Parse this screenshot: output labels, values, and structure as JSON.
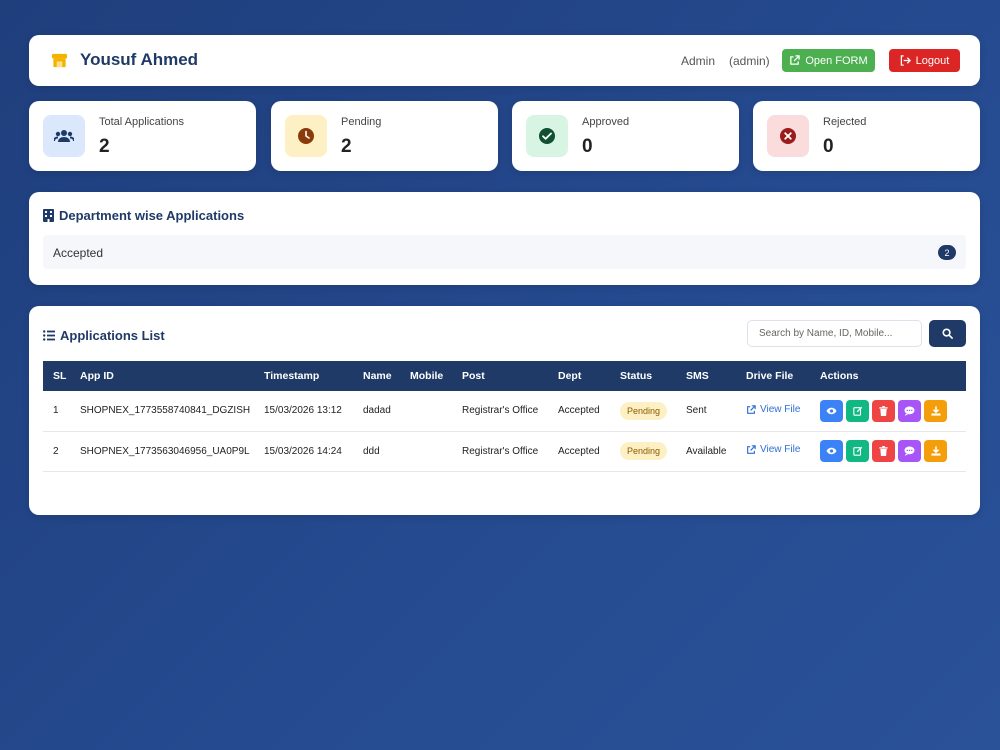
{
  "header": {
    "title": "Yousuf Ahmed",
    "role": "Admin",
    "role_paren": "(admin)",
    "open_form_label": "Open FORM",
    "logout_label": "Logout"
  },
  "stats": [
    {
      "label": "Total Applications",
      "value": "2",
      "icon": "users-icon",
      "bg": "#dbe8fb",
      "color": "#1f3a66"
    },
    {
      "label": "Pending",
      "value": "2",
      "icon": "clock-icon",
      "bg": "#fdf0c4",
      "color": "#8a3b0a"
    },
    {
      "label": "Approved",
      "value": "0",
      "icon": "check-circle-icon",
      "bg": "#d8f5e3",
      "color": "#0f5132"
    },
    {
      "label": "Rejected",
      "value": "0",
      "icon": "x-circle-icon",
      "bg": "#fadcdc",
      "color": "#9b1c1c"
    }
  ],
  "department": {
    "title": "Department wise Applications",
    "items": [
      {
        "name": "Accepted",
        "count": "2"
      }
    ]
  },
  "applications": {
    "title": "Applications List",
    "search_placeholder": "Search by Name, ID, Mobile...",
    "columns": [
      "SL",
      "App ID",
      "Timestamp",
      "Name",
      "Mobile",
      "Post",
      "Dept",
      "Status",
      "SMS",
      "Drive File",
      "Actions"
    ],
    "rows": [
      {
        "sl": "1",
        "app_id": "SHOPNEX_1773558740841_DGZISH",
        "timestamp": "15/03/2026 13:12",
        "name": "dadad",
        "mobile": "",
        "post": "Registrar's Office",
        "dept": "Accepted",
        "status": "Pending",
        "sms": "Sent",
        "drive": "View File"
      },
      {
        "sl": "2",
        "app_id": "SHOPNEX_1773563046956_UA0P9L",
        "timestamp": "15/03/2026 14:24",
        "name": "ddd",
        "mobile": "",
        "post": "Registrar's Office",
        "dept": "Accepted",
        "status": "Pending",
        "sms": "Available",
        "drive": "View File"
      }
    ],
    "actions": [
      {
        "icon": "eye-icon",
        "color": "#3b82f6"
      },
      {
        "icon": "edit-icon",
        "color": "#10b981"
      },
      {
        "icon": "trash-icon",
        "color": "#ef4444"
      },
      {
        "icon": "message-icon",
        "color": "#a855f7"
      },
      {
        "icon": "download-icon",
        "color": "#f59e0b"
      }
    ]
  }
}
